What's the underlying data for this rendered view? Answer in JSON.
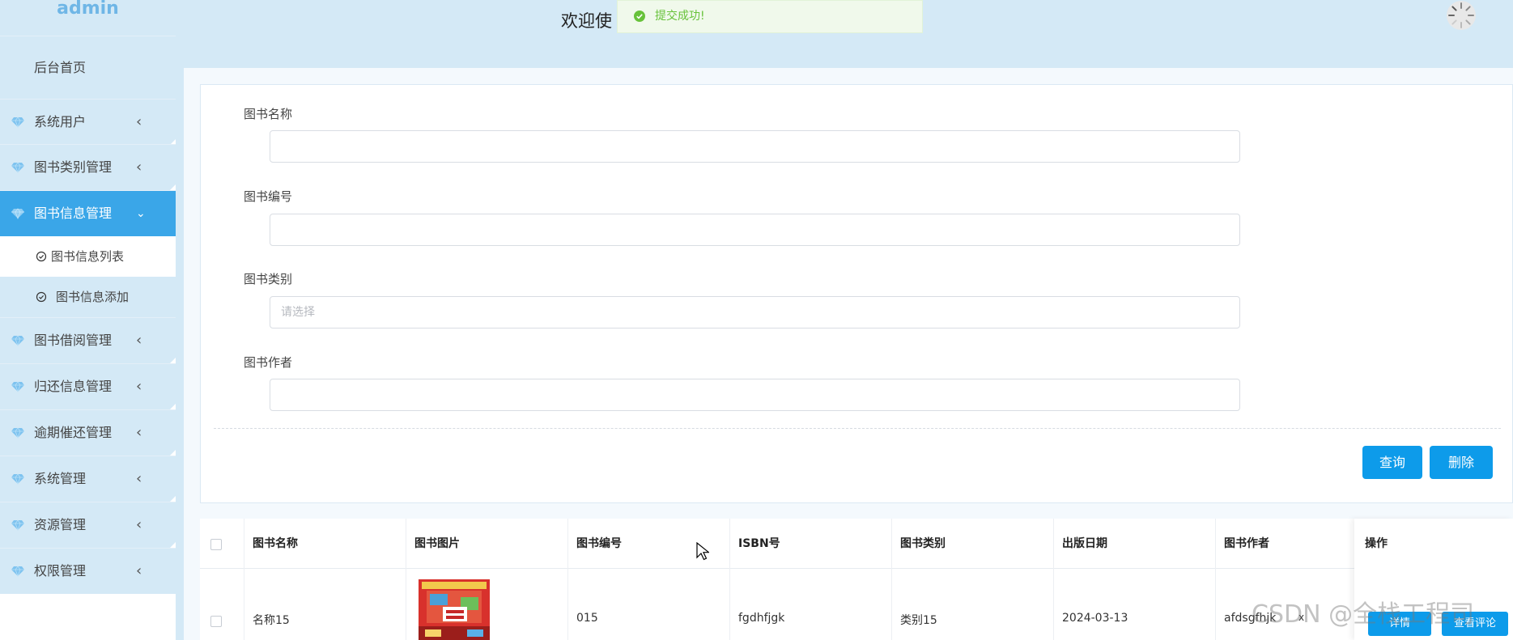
{
  "sidebar": {
    "brand": "admin",
    "home": "后台首页",
    "items": [
      {
        "label": "系统用户"
      },
      {
        "label": "图书类别管理"
      },
      {
        "label": "图书信息管理"
      },
      {
        "label": "图书借阅管理"
      },
      {
        "label": "归还信息管理"
      },
      {
        "label": "逾期催还管理"
      },
      {
        "label": "系统管理"
      },
      {
        "label": "资源管理"
      },
      {
        "label": "权限管理"
      }
    ],
    "active_item": "图书信息管理",
    "sub_items": [
      {
        "label": "图书信息列表"
      },
      {
        "label": "图书信息添加"
      }
    ]
  },
  "header": {
    "welcome": "欢迎使",
    "toast": "提交成功!"
  },
  "search": {
    "fields": [
      {
        "label": "图书名称",
        "value": "",
        "placeholder": ""
      },
      {
        "label": "图书编号",
        "value": "",
        "placeholder": ""
      },
      {
        "label": "图书类别",
        "value": "",
        "placeholder": "请选择"
      },
      {
        "label": "图书作者",
        "value": "",
        "placeholder": ""
      }
    ],
    "query_button": "查询",
    "delete_button": "删除"
  },
  "table": {
    "columns": [
      "图书名称",
      "图书图片",
      "图书编号",
      "ISBN号",
      "图书类别",
      "出版日期",
      "图书作者",
      "操作"
    ],
    "rows": [
      {
        "name": "名称15",
        "number": "015",
        "isbn": "fgdhfjgk",
        "category": "类别15",
        "date": "2024-03-13",
        "author": "afdsgfhjk",
        "x_mark": "x",
        "actions": [
          "详情",
          "查看评论"
        ]
      }
    ]
  },
  "watermark": "CSDN @全栈工程司",
  "colors": {
    "primary": "#0d9bea",
    "sidebar_bg": "#d4e9f6",
    "sidebar_active": "#3aa6e8",
    "success": "#67c23a"
  },
  "icons": [
    "diamond-icon",
    "chevron-left-icon",
    "chevron-down-icon",
    "check-circle-icon",
    "success-icon",
    "loading-avatar-icon",
    "mouse-cursor-icon"
  ]
}
